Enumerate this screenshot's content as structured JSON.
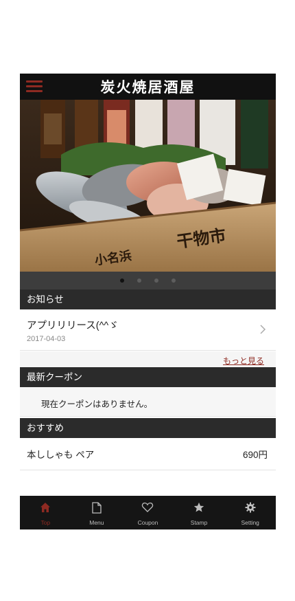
{
  "header": {
    "logo_text": "炭火焼居酒屋"
  },
  "carousel": {
    "slide_count": 4,
    "active_index": 0,
    "image_description": "dried fish in wooden box"
  },
  "news": {
    "section_title": "お知らせ",
    "items": [
      {
        "title": "アプリリリース(^^ゞ",
        "date": "2017-04-03"
      }
    ],
    "more_link": "もっと見る"
  },
  "coupons": {
    "section_title": "最新クーポン",
    "empty_text": "現在クーポンはありません。"
  },
  "recommend": {
    "section_title": "おすすめ",
    "items": [
      {
        "name": "本ししゃも ペア",
        "price": "690円"
      }
    ]
  },
  "tabbar": {
    "active": "Top",
    "tabs": [
      {
        "label": "Top",
        "icon": "home-icon"
      },
      {
        "label": "Menu",
        "icon": "document-icon"
      },
      {
        "label": "Coupon",
        "icon": "heart-icon"
      },
      {
        "label": "Stamp",
        "icon": "star-icon"
      },
      {
        "label": "Setting",
        "icon": "gear-icon"
      }
    ]
  },
  "colors": {
    "accent": "#8e2a22",
    "header_bg": "#111111",
    "section_bg": "#2b2b2b",
    "tabbar_bg": "#151515"
  }
}
